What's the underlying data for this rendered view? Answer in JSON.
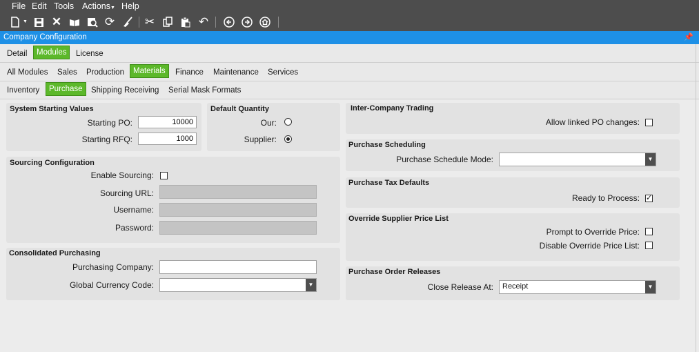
{
  "menu": {
    "file": "File",
    "edit": "Edit",
    "tools": "Tools",
    "actions": "Actions",
    "help": "Help"
  },
  "window_title": "Company Configuration",
  "tabs_l1": {
    "detail": "Detail",
    "modules": "Modules",
    "license": "License"
  },
  "tabs_l2": {
    "all": "All Modules",
    "sales": "Sales",
    "production": "Production",
    "materials": "Materials",
    "finance": "Finance",
    "maintenance": "Maintenance",
    "services": "Services"
  },
  "tabs_l3": {
    "inventory": "Inventory",
    "purchase": "Purchase",
    "shipping": "Shipping Receiving",
    "serial": "Serial Mask Formats"
  },
  "system_starting": {
    "title": "System Starting Values",
    "po_label": "Starting PO:",
    "po_value": "10000",
    "rfq_label": "Starting RFQ:",
    "rfq_value": "1000"
  },
  "default_qty": {
    "title": "Default Quantity",
    "our_label": "Our:",
    "supplier_label": "Supplier:",
    "selected": "supplier"
  },
  "sourcing": {
    "title": "Sourcing Configuration",
    "enable_label": "Enable Sourcing:",
    "url_label": "Sourcing URL:",
    "user_label": "Username:",
    "pass_label": "Password:"
  },
  "consolidated": {
    "title": "Consolidated Purchasing",
    "company_label": "Purchasing Company:",
    "currency_label": "Global Currency Code:"
  },
  "intercompany": {
    "title": "Inter-Company Trading",
    "linked_label": "Allow linked PO changes:"
  },
  "scheduling": {
    "title": "Purchase Scheduling",
    "mode_label": "Purchase Schedule Mode:",
    "mode_value": ""
  },
  "tax": {
    "title": "Purchase Tax Defaults",
    "ready_label": "Ready to Process:",
    "ready_checked": "✓"
  },
  "override": {
    "title": "Override Supplier Price List",
    "prompt_label": "Prompt to Override Price:",
    "disable_label": "Disable Override Price List:"
  },
  "releases": {
    "title": "Purchase Order Releases",
    "close_label": "Close Release At:",
    "close_value": "Receipt"
  }
}
